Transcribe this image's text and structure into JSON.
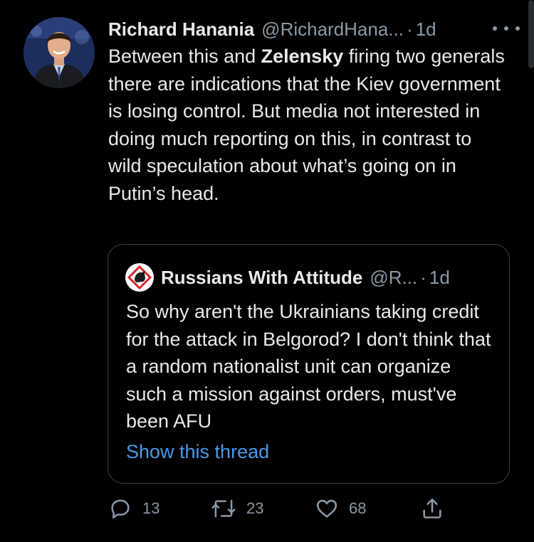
{
  "tweet": {
    "author_name": "Richard Hanania",
    "author_handle": "@RichardHana...",
    "separator": "·",
    "time": "1d",
    "body_pre": "Between this and ",
    "body_bold": "Zelensky",
    "body_post": " firing two generals there are indications that the Kiev government is losing control. But media not interested in doing much reporting on this, in contrast to wild speculation about what’s going on in Putin’s head."
  },
  "quote": {
    "author_name": "Russians With Attitude",
    "author_handle": "@R...",
    "separator": "·",
    "time": "1d",
    "text": "So why aren't the Ukrainians taking credit for the attack in Belgorod? I don't think that a random nationalist unit can organize such a mission against orders, must've been AFU",
    "link_label": "Show this thread"
  },
  "actions": {
    "reply_count": "13",
    "retweet_count": "23",
    "like_count": "68"
  },
  "icons": [
    "more-icon",
    "reply-icon",
    "retweet-icon",
    "like-icon",
    "share-icon"
  ],
  "colors": {
    "background": "#000000",
    "text": "#e7e9ea",
    "secondary": "#8b98a5",
    "link": "#4a99e9",
    "border": "#3a3f44"
  }
}
